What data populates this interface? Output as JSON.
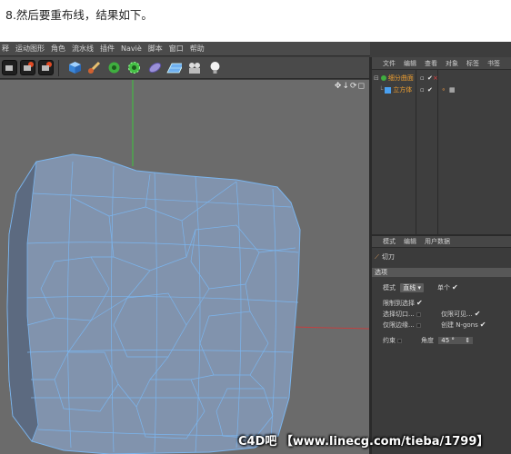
{
  "caption": "8.然后要重布线，结果如下。",
  "menu": [
    "释",
    "运动图形",
    "角色",
    "流水线",
    "插件",
    "Naviè",
    "脚本",
    "窗口",
    "帮助"
  ],
  "toolbar": {
    "icons": [
      "film-clapper-icon",
      "film-clapper-icon",
      "film-clapper-icon",
      "cube-icon",
      "pen-icon",
      "gear-green-icon",
      "gear-green-icon",
      "capsule-icon",
      "plane-grid-icon",
      "camera-icon",
      "light-bulb-icon"
    ]
  },
  "viewport": {
    "nav": "✥↓⟳◻"
  },
  "object_manager": {
    "tabs": [
      "文件",
      "编辑",
      "查看",
      "对象",
      "标签",
      "书签"
    ],
    "objects": [
      {
        "name": "细分曲面",
        "indent": 0
      },
      {
        "name": "立方体",
        "indent": 1
      }
    ]
  },
  "attribute_manager": {
    "tabs": [
      "模式",
      "编辑",
      "用户数据"
    ],
    "tool_name": "切刀",
    "section": "选项",
    "mode_label": "模式",
    "mode_value": "直线",
    "single_label": "单个",
    "restrict_label": "限制到选择",
    "select_cuts_label": "选择切口...",
    "visible_only_label": "仅限可见...",
    "edges_only_label": "仅限边缘...",
    "create_ngons_label": "创建 N-gons",
    "constrain_label": "约束",
    "angle_label": "角度",
    "angle_value": "45 °"
  },
  "watermark": "C4D吧 【www.linecg.com/tieba/1799】",
  "colors": {
    "mesh_fill": "#7f8fa8",
    "wire": "#7bb5ee",
    "viewport_bg": "#6b6b6b",
    "accent_orange": "#f0a030"
  }
}
